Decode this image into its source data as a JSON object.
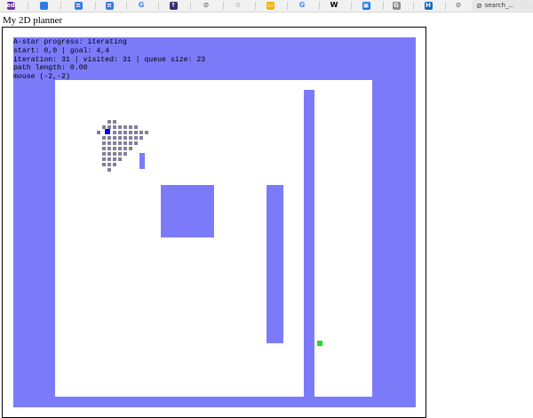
{
  "bookmarks": [
    {
      "name": "ed-favicon-icon",
      "glyph": "ed",
      "color": "#6a2fa3"
    },
    {
      "name": "blue-multicolor-favicon-icon",
      "glyph": "",
      "color": "#2f7be6"
    },
    {
      "name": "docs-favicon-icon",
      "glyph": "≡",
      "color": "#3b78e7"
    },
    {
      "name": "docs-favicon-icon",
      "glyph": "≡",
      "color": "#3b78e7"
    },
    {
      "name": "google-favicon-icon",
      "glyph": "G",
      "color": "#4285f4"
    },
    {
      "name": "upload-favicon-icon",
      "glyph": "↑",
      "color": "#3a2d6e"
    },
    {
      "name": "compass-icon",
      "glyph": "⊘",
      "color": "#777777"
    },
    {
      "name": "star-icon",
      "glyph": "☆",
      "color": "#777777"
    },
    {
      "name": "slides-favicon-icon",
      "glyph": "▭",
      "color": "#f4b400"
    },
    {
      "name": "google-favicon-icon",
      "glyph": "G",
      "color": "#4285f4"
    },
    {
      "name": "wikipedia-favicon-icon",
      "glyph": "W",
      "color": "#000000"
    },
    {
      "name": "robot-favicon-icon",
      "glyph": "▣",
      "color": "#1a73e8"
    },
    {
      "name": "grey-g-favicon-icon",
      "glyph": "G",
      "color": "#8a8a8a"
    },
    {
      "name": "h-favicon-icon",
      "glyph": "H",
      "color": "#1565c0"
    },
    {
      "name": "compass-icon",
      "glyph": "⊘",
      "color": "#777777"
    }
  ],
  "search_chip": {
    "icon": "compass-icon",
    "label": "search_..."
  },
  "page_title": "My 2D planner",
  "status": {
    "line1": "A-star progress: iterating",
    "line2": "start: 0,0 | goal: 4,4",
    "line3": "iteration: 31 | visited: 31 | queue size: 23",
    "line4": "path length: 0.00",
    "line5": "mouse (-2,-2)"
  },
  "colors": {
    "obstacle": "#7b7bfa",
    "free": "#ffffff",
    "visited": "#80809a",
    "current": "#0000ee",
    "goal": "#22dd22"
  }
}
